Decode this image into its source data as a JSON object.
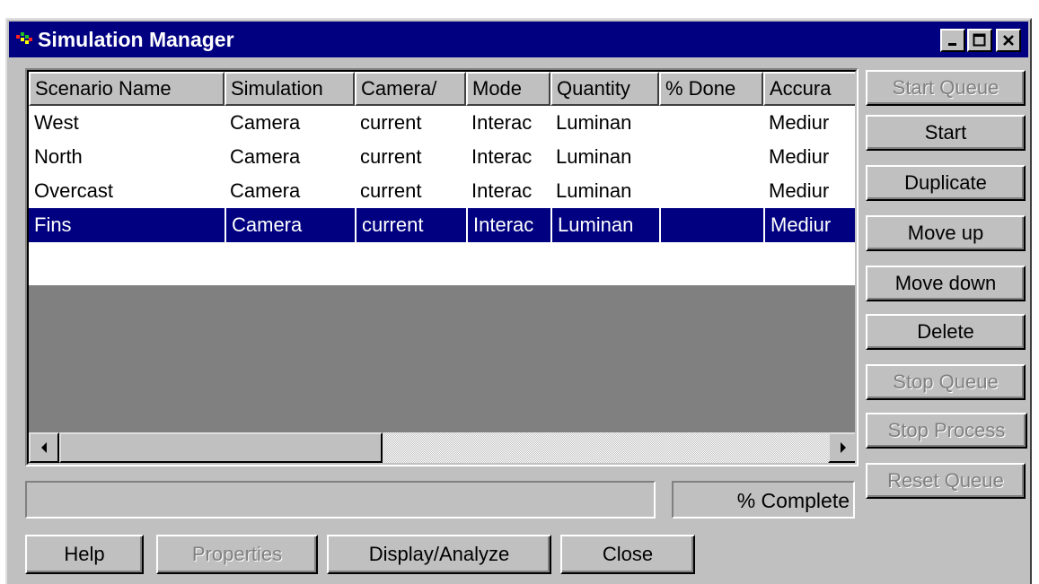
{
  "window": {
    "title": "Simulation Manager",
    "minimize_symbol": "▁",
    "maximize_symbol": "□",
    "close_symbol": "✕"
  },
  "table": {
    "columns": [
      "Scenario Name",
      "Simulation",
      "Camera/",
      "Mode",
      "Quantity",
      "% Done",
      "Accura"
    ],
    "rows": [
      {
        "scenario": "West",
        "simulation": "Camera",
        "camera": "current",
        "mode": "Interac",
        "quantity": "Luminan",
        "done": "",
        "accuracy": "Mediur"
      },
      {
        "scenario": "North",
        "simulation": "Camera",
        "camera": "current",
        "mode": "Interac",
        "quantity": "Luminan",
        "done": "",
        "accuracy": "Mediur"
      },
      {
        "scenario": "Overcast",
        "simulation": "Camera",
        "camera": "current",
        "mode": "Interac",
        "quantity": "Luminan",
        "done": "",
        "accuracy": "Mediur"
      },
      {
        "scenario": "Fins",
        "simulation": "Camera",
        "camera": "current",
        "mode": "Interac",
        "quantity": "Luminan",
        "done": "",
        "accuracy": "Mediur",
        "selected": true
      }
    ]
  },
  "progress": {
    "label": "% Complete",
    "value": 0
  },
  "side_buttons": {
    "start_queue": "Start Queue",
    "start": "Start",
    "duplicate": "Duplicate",
    "move_up": "Move up",
    "move_down": "Move down",
    "delete": "Delete",
    "stop_queue": "Stop Queue",
    "stop_process": "Stop Process",
    "reset_queue": "Reset Queue"
  },
  "bottom_buttons": {
    "help": "Help",
    "properties": "Properties",
    "display_analyze": "Display/Analyze",
    "close": "Close"
  },
  "colors": {
    "titlebar": "#000080",
    "face": "#c0c0c0",
    "selection": "#000080"
  }
}
